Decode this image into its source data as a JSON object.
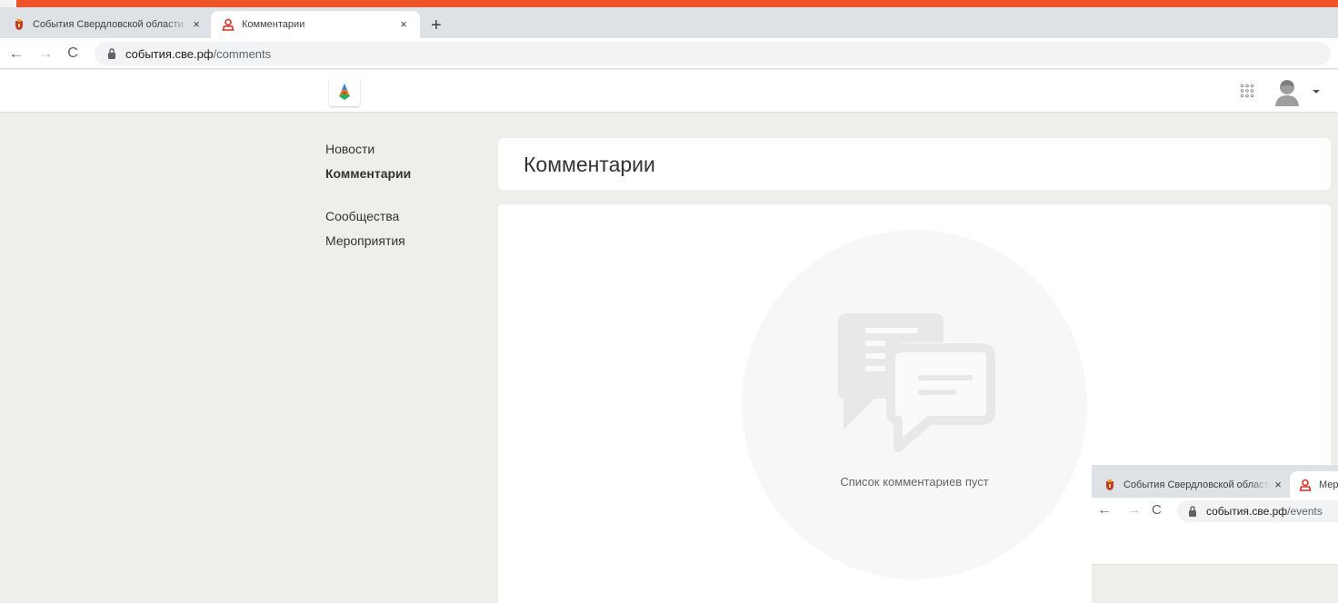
{
  "browser": {
    "tabs": [
      {
        "title": "События Свердловской области",
        "active": false,
        "icon": "coat-of-arms-icon"
      },
      {
        "title": "Комментарии",
        "active": true,
        "icon": "user-outline-icon"
      }
    ],
    "close_glyph": "×",
    "new_tab_glyph": "+",
    "back_glyph": "←",
    "forward_glyph": "→",
    "reload_glyph": "C",
    "url_host": "события.све.рф",
    "url_path": "/comments",
    "accent_color": "#ee5428"
  },
  "site": {
    "logo": "site-logo",
    "apps_icon": "apps-grid-icon",
    "avatar_icon": "user-avatar-icon"
  },
  "sidebar": {
    "items": [
      {
        "label": "Новости",
        "active": false
      },
      {
        "label": "Комментарии",
        "active": true
      },
      {
        "label": "Сообщества",
        "active": false
      },
      {
        "label": "Мероприятия",
        "active": false
      }
    ]
  },
  "main": {
    "title": "Комментарии",
    "empty_icon": "chat-bubbles-icon",
    "empty_text": "Список комментариев пуст"
  },
  "overlay_browser": {
    "tabs": [
      {
        "title": "События Свердловской области",
        "active": false
      },
      {
        "title": "Мероприятия",
        "active": true
      }
    ],
    "close_glyph": "×",
    "url_host": "события.све.рф",
    "url_path": "/events"
  }
}
